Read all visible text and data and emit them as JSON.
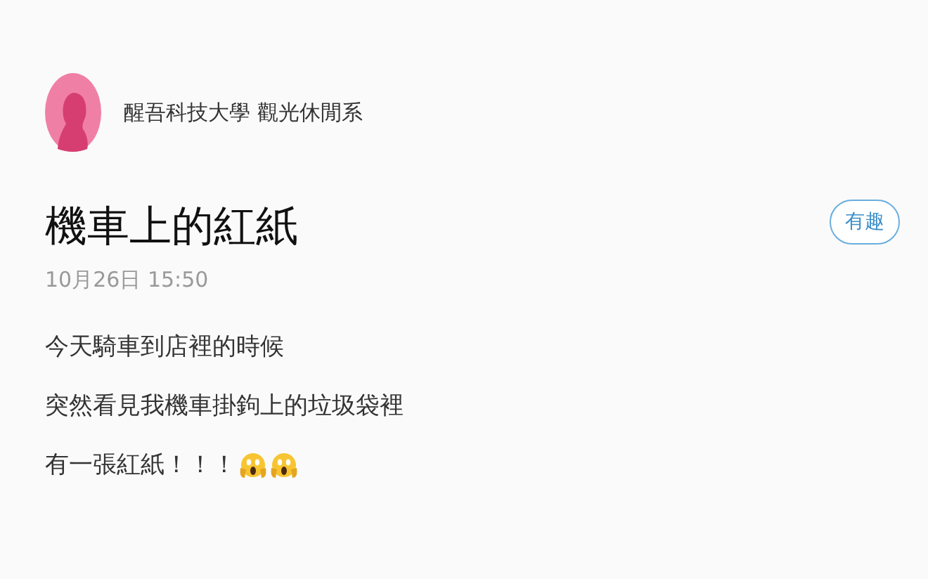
{
  "author": {
    "name": "醒吾科技大學 觀光休閒系"
  },
  "post": {
    "title": "機車上的紅紙",
    "date": "10月26日 15:50",
    "follow_button": "有趣",
    "lines": [
      {
        "text": "今天騎車到店裡的時候"
      },
      {
        "text": "突然看見我機車掛鉤上的垃圾袋裡"
      },
      {
        "text": "有一張紅紙！！！",
        "reactions": [
          {
            "kind": "scream"
          },
          {
            "kind": "scream"
          }
        ]
      }
    ]
  }
}
